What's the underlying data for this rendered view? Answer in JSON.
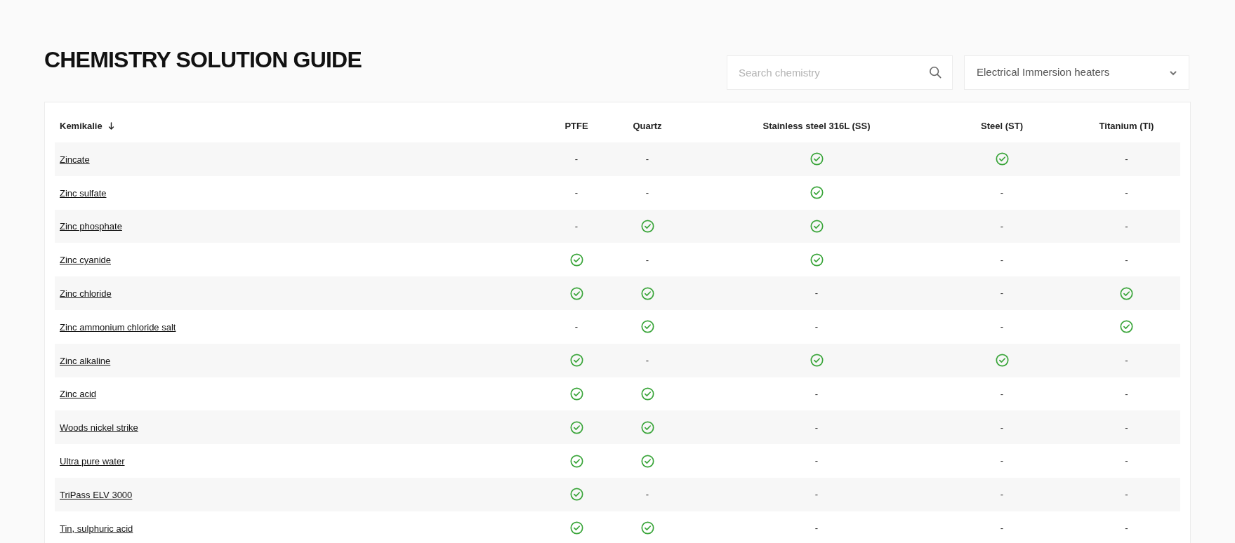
{
  "title": "CHEMISTRY SOLUTION GUIDE",
  "search": {
    "placeholder": "Search chemistry"
  },
  "filter": {
    "value": "Electrical Immersion heaters"
  },
  "table": {
    "columns": [
      {
        "label": "Kemikalie",
        "sorted": true
      },
      {
        "label": "PTFE"
      },
      {
        "label": "Quartz"
      },
      {
        "label": "Stainless steel 316L (SS)"
      },
      {
        "label": "Steel (ST)"
      },
      {
        "label": "Titanium (TI)"
      }
    ],
    "rows": [
      [
        {
          "kind": "link",
          "text": "Zincate"
        },
        {
          "kind": "dash",
          "text": "-"
        },
        {
          "kind": "dash",
          "text": "-"
        },
        {
          "kind": "check"
        },
        {
          "kind": "check"
        },
        {
          "kind": "dash",
          "text": "-"
        }
      ],
      [
        {
          "kind": "link",
          "text": "Zinc sulfate"
        },
        {
          "kind": "dash",
          "text": "-"
        },
        {
          "kind": "dash",
          "text": "-"
        },
        {
          "kind": "check"
        },
        {
          "kind": "dash",
          "text": "-"
        },
        {
          "kind": "dash",
          "text": "-"
        }
      ],
      [
        {
          "kind": "link",
          "text": "Zinc phosphate"
        },
        {
          "kind": "dash",
          "text": "-"
        },
        {
          "kind": "check"
        },
        {
          "kind": "check"
        },
        {
          "kind": "dash",
          "text": "-"
        },
        {
          "kind": "dash",
          "text": "-"
        }
      ],
      [
        {
          "kind": "link",
          "text": "Zinc cyanide"
        },
        {
          "kind": "check"
        },
        {
          "kind": "dash",
          "text": "-"
        },
        {
          "kind": "check"
        },
        {
          "kind": "dash",
          "text": "-"
        },
        {
          "kind": "dash",
          "text": "-"
        }
      ],
      [
        {
          "kind": "link",
          "text": "Zinc chloride"
        },
        {
          "kind": "check"
        },
        {
          "kind": "check"
        },
        {
          "kind": "dash",
          "text": "-"
        },
        {
          "kind": "dash",
          "text": "-"
        },
        {
          "kind": "check"
        }
      ],
      [
        {
          "kind": "link",
          "text": "Zinc ammonium chloride salt"
        },
        {
          "kind": "dash",
          "text": "-"
        },
        {
          "kind": "check"
        },
        {
          "kind": "dash",
          "text": "-"
        },
        {
          "kind": "dash",
          "text": "-"
        },
        {
          "kind": "check"
        }
      ],
      [
        {
          "kind": "link",
          "text": "Zinc alkaline"
        },
        {
          "kind": "check"
        },
        {
          "kind": "dash",
          "text": "-"
        },
        {
          "kind": "check"
        },
        {
          "kind": "check"
        },
        {
          "kind": "dash",
          "text": "-"
        }
      ],
      [
        {
          "kind": "link",
          "text": "Zinc acid"
        },
        {
          "kind": "check"
        },
        {
          "kind": "check"
        },
        {
          "kind": "dash",
          "text": "-"
        },
        {
          "kind": "dash",
          "text": "-"
        },
        {
          "kind": "dash",
          "text": "-"
        }
      ],
      [
        {
          "kind": "link",
          "text": "Woods nickel strike"
        },
        {
          "kind": "check"
        },
        {
          "kind": "check"
        },
        {
          "kind": "dash",
          "text": "-"
        },
        {
          "kind": "dash",
          "text": "-"
        },
        {
          "kind": "dash",
          "text": "-"
        }
      ],
      [
        {
          "kind": "link",
          "text": "Ultra pure water"
        },
        {
          "kind": "check"
        },
        {
          "kind": "check"
        },
        {
          "kind": "dash",
          "text": "-"
        },
        {
          "kind": "dash",
          "text": "-"
        },
        {
          "kind": "dash",
          "text": "-"
        }
      ],
      [
        {
          "kind": "link",
          "text": "TriPass ELV 3000"
        },
        {
          "kind": "check"
        },
        {
          "kind": "dash",
          "text": "-"
        },
        {
          "kind": "dash",
          "text": "-"
        },
        {
          "kind": "dash",
          "text": "-"
        },
        {
          "kind": "dash",
          "text": "-"
        }
      ],
      [
        {
          "kind": "link",
          "text": "Tin, sulphuric acid"
        },
        {
          "kind": "check"
        },
        {
          "kind": "check"
        },
        {
          "kind": "dash",
          "text": "-"
        },
        {
          "kind": "dash",
          "text": "-"
        },
        {
          "kind": "dash",
          "text": "-"
        }
      ]
    ]
  }
}
